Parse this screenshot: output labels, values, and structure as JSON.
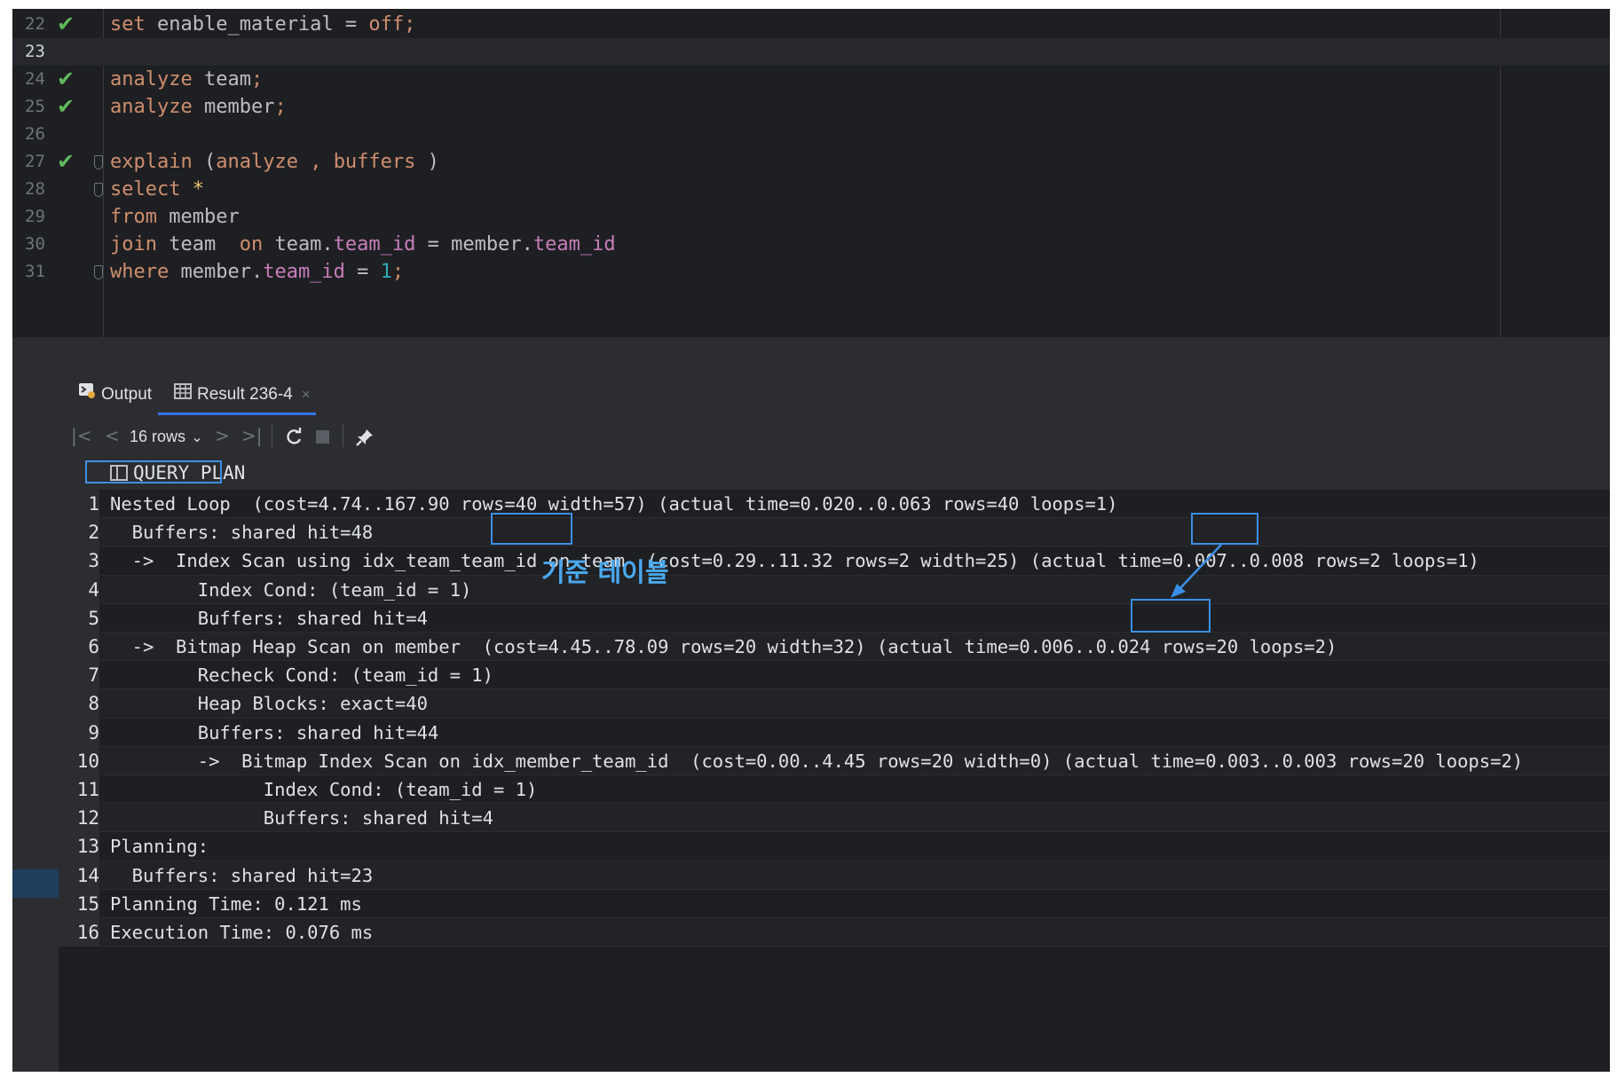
{
  "editor": {
    "lines": [
      {
        "num": "22",
        "check": true,
        "fold": false,
        "tokens": [
          [
            "kw",
            "set"
          ],
          [
            "txt",
            " enable_material = "
          ],
          [
            "kw",
            "off"
          ],
          [
            "punc",
            ";"
          ]
        ]
      },
      {
        "num": "23",
        "check": false,
        "fold": false,
        "current": true,
        "tokens": []
      },
      {
        "num": "24",
        "check": true,
        "fold": false,
        "tokens": [
          [
            "kw",
            "analyze"
          ],
          [
            "txt",
            " team"
          ],
          [
            "punc",
            ";"
          ]
        ]
      },
      {
        "num": "25",
        "check": true,
        "fold": false,
        "tokens": [
          [
            "kw",
            "analyze"
          ],
          [
            "txt",
            " member"
          ],
          [
            "punc",
            ";"
          ]
        ]
      },
      {
        "num": "26",
        "check": false,
        "fold": false,
        "tokens": []
      },
      {
        "num": "27",
        "check": true,
        "fold": true,
        "tokens": [
          [
            "kw",
            "explain"
          ],
          [
            "txt",
            " ("
          ],
          [
            "kw",
            "analyze"
          ],
          [
            "txt",
            " "
          ],
          [
            "punc",
            ","
          ],
          [
            "txt",
            " "
          ],
          [
            "kw",
            "buffers"
          ],
          [
            "txt",
            " )"
          ]
        ]
      },
      {
        "num": "28",
        "check": false,
        "fold": true,
        "tokens": [
          [
            "kw",
            "select"
          ],
          [
            "txt",
            " "
          ],
          [
            "star",
            "*"
          ]
        ]
      },
      {
        "num": "29",
        "check": false,
        "fold": false,
        "tokens": [
          [
            "kw",
            "from"
          ],
          [
            "txt",
            " member"
          ]
        ]
      },
      {
        "num": "30",
        "check": false,
        "fold": false,
        "tokens": [
          [
            "kw",
            "join"
          ],
          [
            "txt",
            " team  "
          ],
          [
            "kw",
            "on"
          ],
          [
            "txt",
            " team."
          ],
          [
            "fld",
            "team_id"
          ],
          [
            "txt",
            " = member."
          ],
          [
            "fld",
            "team_id"
          ]
        ]
      },
      {
        "num": "31",
        "check": false,
        "fold": true,
        "tokens": [
          [
            "kw",
            "where"
          ],
          [
            "txt",
            " member."
          ],
          [
            "fld",
            "team_id"
          ],
          [
            "txt",
            " = "
          ],
          [
            "num",
            "1"
          ],
          [
            "punc",
            ";"
          ]
        ]
      }
    ]
  },
  "tabs": {
    "output_label": "Output",
    "result_label": "Result 236-4",
    "close_glyph": "×"
  },
  "toolbar": {
    "rows_label": "16 rows",
    "first_glyph": "|<",
    "prev_glyph": "<",
    "next_glyph": ">",
    "last_glyph": ">|",
    "dropdown_glyph": "⌄"
  },
  "grid": {
    "column_header": "QUERY PLAN",
    "rows": [
      {
        "n": "1",
        "text": "Nested Loop  (cost=4.74..167.90 rows=40 width=57) (actual time=0.020..0.063 rows=40 loops=1)"
      },
      {
        "n": "2",
        "text": "  Buffers: shared hit=48"
      },
      {
        "n": "3",
        "text": "  ->  Index Scan using idx_team_team_id on team  (cost=0.29..11.32 rows=2 width=25) (actual time=0.007..0.008 rows=2 loops=1)"
      },
      {
        "n": "4",
        "text": "        Index Cond: (team_id = 1)"
      },
      {
        "n": "5",
        "text": "        Buffers: shared hit=4"
      },
      {
        "n": "6",
        "text": "  ->  Bitmap Heap Scan on member  (cost=4.45..78.09 rows=20 width=32) (actual time=0.006..0.024 rows=20 loops=2)"
      },
      {
        "n": "7",
        "text": "        Recheck Cond: (team_id = 1)"
      },
      {
        "n": "8",
        "text": "        Heap Blocks: exact=40"
      },
      {
        "n": "9",
        "text": "        Buffers: shared hit=44"
      },
      {
        "n": "10",
        "text": "        ->  Bitmap Index Scan on idx_member_team_id  (cost=0.00..4.45 rows=20 width=0) (actual time=0.003..0.003 rows=20 loops=2)"
      },
      {
        "n": "11",
        "text": "              Index Cond: (team_id = 1)"
      },
      {
        "n": "12",
        "text": "              Buffers: shared hit=4"
      },
      {
        "n": "13",
        "text": "Planning:"
      },
      {
        "n": "14",
        "text": "  Buffers: shared hit=23"
      },
      {
        "n": "15",
        "text": "Planning Time: 0.121 ms"
      },
      {
        "n": "16",
        "text": "Execution Time: 0.076 ms"
      }
    ]
  },
  "annotation": {
    "label": "기준 테이블",
    "color": "#3b8fe6"
  }
}
